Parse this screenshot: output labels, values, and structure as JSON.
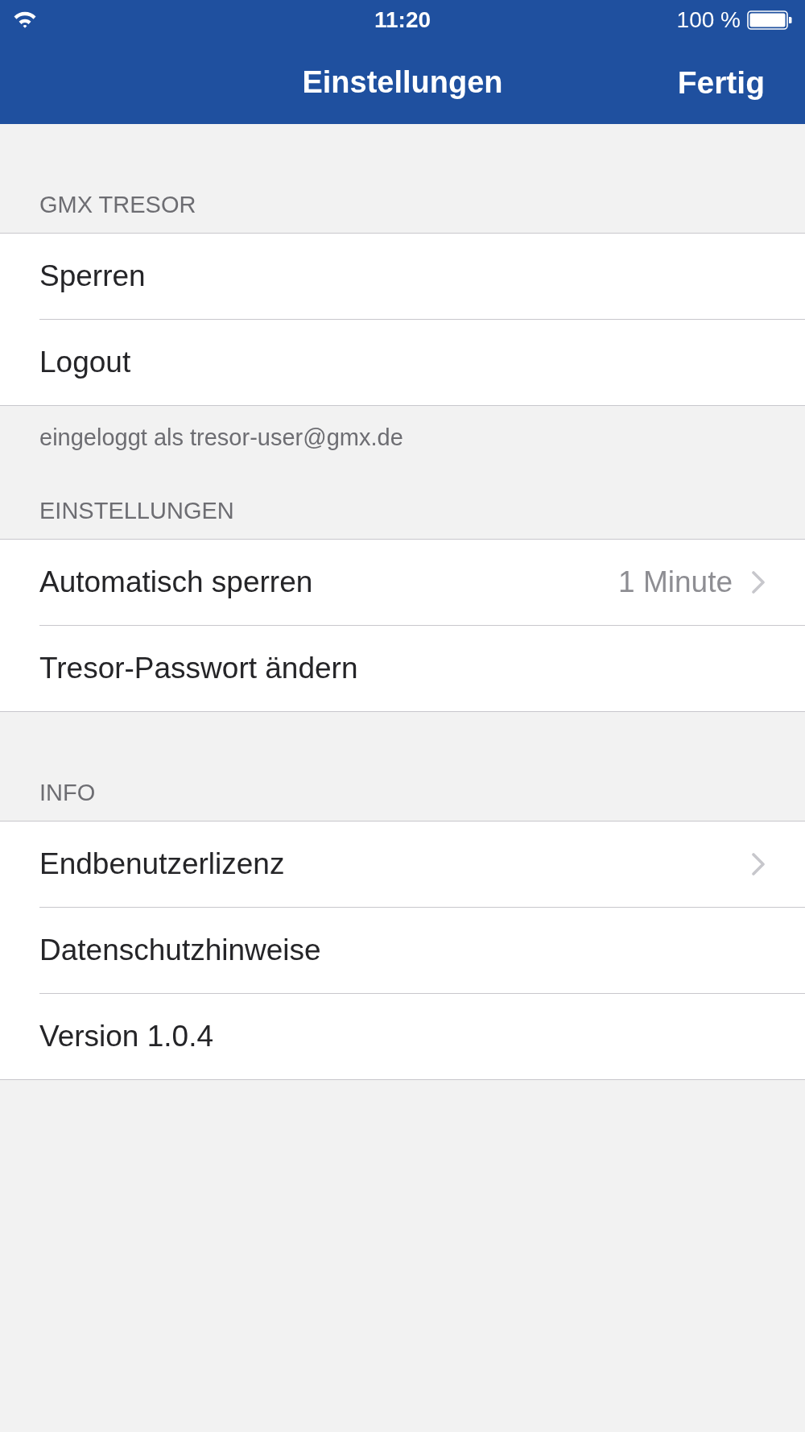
{
  "status_bar": {
    "time": "11:20",
    "battery": "100 %"
  },
  "nav_bar": {
    "title": "Einstellungen",
    "done_button": "Fertig"
  },
  "sections": [
    {
      "header": "GMX TRESOR",
      "rows": [
        {
          "label": "Sperren",
          "disclosure": false
        },
        {
          "label": "Logout",
          "disclosure": false
        }
      ],
      "footer": "eingeloggt als tresor-user@gmx.de"
    },
    {
      "header": "EINSTELLUNGEN",
      "rows": [
        {
          "label": "Automatisch sperren",
          "value": "1 Minute",
          "disclosure": true
        },
        {
          "label": "Tresor-Passwort ändern",
          "disclosure": false
        }
      ]
    },
    {
      "header": "INFO",
      "rows": [
        {
          "label": "Endbenutzerlizenz",
          "disclosure": true
        },
        {
          "label": "Datenschutzhinweise",
          "disclosure": false
        },
        {
          "label": "Version 1.0.4",
          "disclosure": false
        }
      ]
    }
  ]
}
